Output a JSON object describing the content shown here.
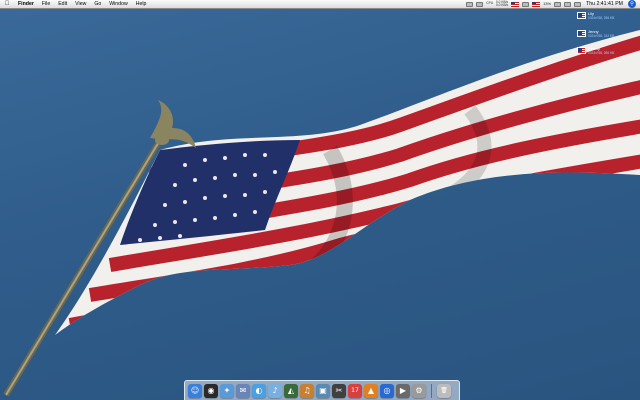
{
  "menubar": {
    "apple": "",
    "items": [
      "Finder",
      "File",
      "Edit",
      "View",
      "Go",
      "Window",
      "Help"
    ],
    "extras": {
      "cpu_label": "CPU",
      "net_in": "0.0 KB/s",
      "net_out": "0.0 KB/s",
      "battery": "13%",
      "clock": "Thu 2:41:41 PM"
    }
  },
  "desktop_icons": [
    {
      "name": "Lily",
      "meta": "1024x768, 256 KB"
    },
    {
      "name": "Jenny",
      "meta": "1024x768, 312 KB"
    },
    {
      "name": "Liberty",
      "meta": "1024x768, 286 KB"
    }
  ],
  "dock": {
    "items": [
      {
        "name": "finder",
        "glyph": "☺",
        "color": "#3a7fd8"
      },
      {
        "name": "dashboard",
        "glyph": "◉",
        "color": "#2a2a2a"
      },
      {
        "name": "safari",
        "glyph": "✦",
        "color": "#5a9ad8"
      },
      {
        "name": "mail",
        "glyph": "✉",
        "color": "#6a86b8"
      },
      {
        "name": "ichat",
        "glyph": "◐",
        "color": "#4aa0e0"
      },
      {
        "name": "itunes",
        "glyph": "♪",
        "color": "#7ab0e0"
      },
      {
        "name": "iphoto",
        "glyph": "◭",
        "color": "#3a6a3a"
      },
      {
        "name": "garageband",
        "glyph": "♫",
        "color": "#c88030"
      },
      {
        "name": "preview",
        "glyph": "▣",
        "color": "#5a8ab0"
      },
      {
        "name": "imovie",
        "glyph": "✂",
        "color": "#404040"
      },
      {
        "name": "ical",
        "glyph": "17",
        "color": "#d84040"
      },
      {
        "name": "vlc",
        "glyph": "▲",
        "color": "#e08020"
      },
      {
        "name": "firefox",
        "glyph": "◎",
        "color": "#2a6ad0"
      },
      {
        "name": "quicktime",
        "glyph": "▶",
        "color": "#6a6a6a"
      },
      {
        "name": "system-preferences",
        "glyph": "⚙",
        "color": "#9a9a9a"
      },
      {
        "name": "trash",
        "glyph": "🗑",
        "color": "#bcbcbc"
      }
    ]
  }
}
